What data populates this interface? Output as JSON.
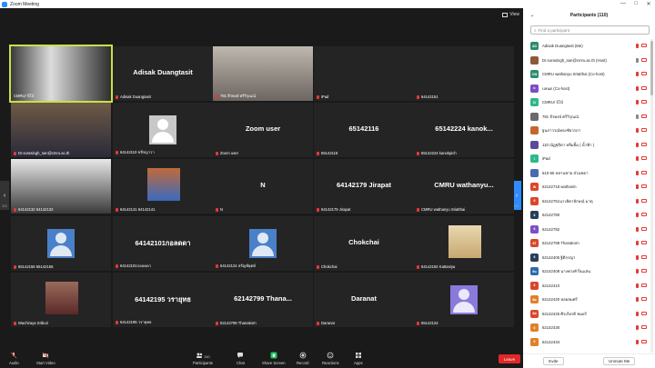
{
  "window": {
    "title": "Zoom Meeting",
    "controls": [
      "—",
      "□",
      "✕"
    ]
  },
  "view_label": "View",
  "page": {
    "left": "1/3",
    "right": "1/3"
  },
  "tiles": [
    {
      "big": "",
      "label": "CMRU/ บีโบ้"
    },
    {
      "big": "Adisak Duangtasit",
      "label": "Adisak Duangtasit"
    },
    {
      "big": "",
      "label": "781 ธีรพงษ์ ศรีวิรุณณ์"
    },
    {
      "big": "",
      "label": "iPad"
    },
    {
      "big": "",
      "label": "64142151"
    },
    {
      "big": "",
      "label": "Dr.surasingh_san@cmru.ac.th"
    },
    {
      "big": "",
      "label": "64142110 ขจีรญาวา"
    },
    {
      "big": "Zoom user",
      "label": "Zoom user"
    },
    {
      "big": "65142116",
      "label": "65142116"
    },
    {
      "big": "65142224 kanok...",
      "label": "65142224 kanokpich"
    },
    {
      "big": "",
      "label": "64142132 64142132"
    },
    {
      "big": "",
      "label": "64142141 64142141"
    },
    {
      "big": "N",
      "label": "N"
    },
    {
      "big": "64142179 Jirapat",
      "label": "64142179 Jirapat"
    },
    {
      "big": "CMRU wathanyu...",
      "label": "CMRU wathanyu Sriatthai"
    },
    {
      "big": "",
      "label": "65142156 65142156"
    },
    {
      "big": "64142101กอลดดา",
      "label": "64142101กอลดดา"
    },
    {
      "big": "",
      "label": "64142124 สรัญช์ยุตห์"
    },
    {
      "big": "Chokchai",
      "label": "Chokchai"
    },
    {
      "big": "",
      "label": "64142192 Kattaniya"
    },
    {
      "big": "",
      "label": "Wachiraya Sriburi"
    },
    {
      "big": "64142195 วรายุทธ",
      "label": "64142195 วรายุทธ"
    },
    {
      "big": "62142799 Thana...",
      "label": "62142799 Thanakorn"
    },
    {
      "big": "Daranat",
      "label": "Daranat"
    },
    {
      "big": "",
      "label": "65142124"
    }
  ],
  "toolbar": {
    "audio": "Audio",
    "video": "Start Video",
    "participants": "Participants",
    "participants_count": "110",
    "chat": "Chat",
    "share": "Share Screen",
    "record": "Record",
    "reactions": "Reactions",
    "apps": "Apps",
    "end": "Leave"
  },
  "panel": {
    "title": "Participants (110)",
    "search_placeholder": "Find a participant",
    "invite": "Invite",
    "unmute_me": "Unmute Me",
    "participants": [
      {
        "initials": "AD",
        "color": "#2e8b6e",
        "name": "Adisak Duangtasit (Me)",
        "mic_on": false
      },
      {
        "initials": "",
        "color": "#8b5a3c",
        "name": "Dr.surasingh_san@cmru.ac.th (Host)",
        "mic_on": true
      },
      {
        "initials": "CW",
        "color": "#2e8b6e",
        "name": "CMRU wathanyu Sriatthai (Co-host)",
        "mic_on": false
      },
      {
        "initials": "b",
        "color": "#7b4fc9",
        "name": "บลนด (Co-host)",
        "mic_on": false
      },
      {
        "initials": "C/",
        "color": "#2eb88a",
        "name": "CMRU/ บีโบ้",
        "mic_on": false
      },
      {
        "initials": "",
        "color": "#6a6a6a",
        "name": "781 ธีรพงษ์ ศรีวิรุณณ์",
        "mic_on": true
      },
      {
        "initials": "",
        "color": "#c86432",
        "name": "ฐนภาวรณ์ทองชัยวรภา",
        "mic_on": false
      },
      {
        "initials": "",
        "color": "#5a4a9a",
        "name": "110 ณัฏฐุธิดา หลิ่มยิ้ม ( น้ำฟ้า )",
        "mic_on": false
      },
      {
        "initials": "i",
        "color": "#2eb88a",
        "name": "iPad",
        "mic_on": false
      },
      {
        "initials": "",
        "color": "#4a6ab0",
        "name": "610-55 หลานชาย ส่วนชดา",
        "mic_on": false
      },
      {
        "initials": "W",
        "color": "#d9472b",
        "name": "62142718 wathanin",
        "mic_on": false
      },
      {
        "initials": "6",
        "color": "#d9472b",
        "name": "62142751นางลิดาลักษณ์ มาตุ",
        "mic_on": false
      },
      {
        "initials": "6",
        "color": "#283e5a",
        "name": "62142780",
        "mic_on": false
      },
      {
        "initials": "6",
        "color": "#7b4fc9",
        "name": "62142782",
        "mic_on": false
      },
      {
        "initials": "6T",
        "color": "#d9472b",
        "name": "62142799 Thanakorn",
        "mic_on": false
      },
      {
        "initials": "6",
        "color": "#283e5a",
        "name": "62142405 ฐิติกรญา",
        "mic_on": false
      },
      {
        "initials": "6น",
        "color": "#2e6ab0",
        "name": "62142408 นางพวงศ์ ปิ่นแสน",
        "mic_on": false
      },
      {
        "initials": "6",
        "color": "#d9472b",
        "name": "62142410",
        "mic_on": false
      },
      {
        "initials": "6ห",
        "color": "#e0802a",
        "name": "62142420 หอยสมศรี",
        "mic_on": false
      },
      {
        "initials": "6ศ",
        "color": "#d9472b",
        "name": "62142425 ศิรเกียรติ ชมยรี",
        "mic_on": false
      },
      {
        "initials": "6",
        "color": "#e0802a",
        "name": "62142430",
        "mic_on": false
      },
      {
        "initials": "6",
        "color": "#e0802a",
        "name": "62142434",
        "mic_on": false
      }
    ]
  }
}
